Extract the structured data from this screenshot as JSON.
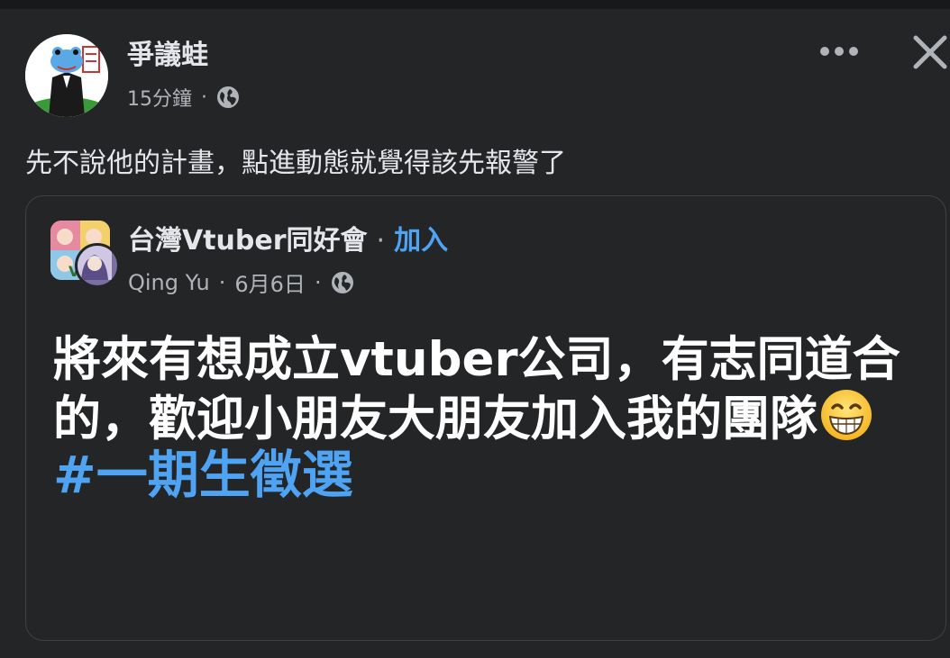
{
  "post": {
    "author": "爭議蛙",
    "time": "15分鐘",
    "separator": "·",
    "text": "先不說他的計畫，點進動態就覺得該先報警了"
  },
  "icons": {
    "avatar": "frog-avatar",
    "privacy": "globe-icon",
    "more": "more-horizontal-icon",
    "close": "close-icon",
    "emoji": "grinning-face-emoji"
  },
  "shared": {
    "group_name": "台灣Vtuber同好會",
    "separator": "·",
    "join_label": "加入",
    "member_name": "Qing Yu",
    "date": "6月6日",
    "body": "將來有想成立vtuber公司，有志同道合的，歡迎小朋友大朋友加入我的團隊",
    "hashtag": "#一期生徵選"
  },
  "colors": {
    "background": "#242526",
    "link": "#4ea3f3",
    "secondary_text": "#b0b3b8"
  }
}
